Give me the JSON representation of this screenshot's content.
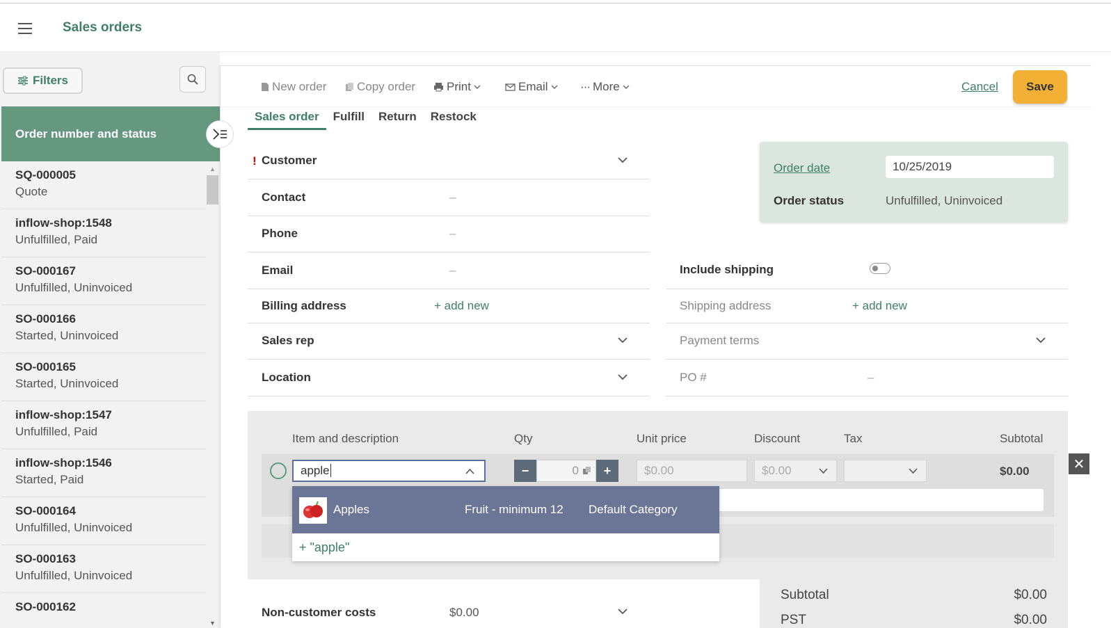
{
  "header": {
    "title": "Sales orders"
  },
  "left": {
    "filters_label": "Filters",
    "list_header": "Order number and status",
    "orders": [
      {
        "num": "SQ-000005",
        "status": "Quote"
      },
      {
        "num": "inflow-shop:1548",
        "status": "Unfulfilled, Paid"
      },
      {
        "num": "SO-000167",
        "status": "Unfulfilled, Uninvoiced"
      },
      {
        "num": "SO-000166",
        "status": "Started, Uninvoiced"
      },
      {
        "num": "SO-000165",
        "status": "Started, Uninvoiced"
      },
      {
        "num": "inflow-shop:1547",
        "status": "Unfulfilled, Paid"
      },
      {
        "num": "inflow-shop:1546",
        "status": "Started, Paid"
      },
      {
        "num": "SO-000164",
        "status": "Unfulfilled, Uninvoiced"
      },
      {
        "num": "SO-000163",
        "status": "Unfulfilled, Uninvoiced"
      },
      {
        "num": "SO-000162",
        "status": ""
      }
    ]
  },
  "toolbar": {
    "new_order": "New order",
    "copy_order": "Copy order",
    "print": "Print",
    "email": "Email",
    "more": "More",
    "cancel": "Cancel",
    "save": "Save"
  },
  "tabs": [
    "Sales order",
    "Fulfill",
    "Return",
    "Restock"
  ],
  "form": {
    "customer": "Customer",
    "required_mark": "!",
    "contact": "Contact",
    "phone": "Phone",
    "email": "Email",
    "billing_address": "Billing address",
    "add_new": "+ add new",
    "sales_rep": "Sales rep",
    "location": "Location",
    "include_shipping": "Include shipping",
    "shipping_address": "Shipping address",
    "payment_terms": "Payment terms",
    "po": "PO #",
    "dash": "–"
  },
  "order_info": {
    "date_label": "Order date",
    "date_value": "10/25/2019",
    "status_label": "Order status",
    "status_value": "Unfulfilled, Uninvoiced"
  },
  "items": {
    "columns": {
      "item": "Item and description",
      "qty": "Qty",
      "unit_price": "Unit price",
      "discount": "Discount",
      "tax": "Tax",
      "subtotal": "Subtotal"
    },
    "row": {
      "item_value": "apple",
      "qty": "0",
      "unit_price": "$0.00",
      "discount": "$0.00",
      "subtotal": "$0.00"
    },
    "dropdown": {
      "name": "Apples",
      "desc": "Fruit - minimum 12",
      "category": "Default Category",
      "add_text": "+  \"apple\""
    }
  },
  "non_customer_costs": {
    "label": "Non-customer costs",
    "value": "$0.00"
  },
  "totals": {
    "subtotal_label": "Subtotal",
    "subtotal_value": "$0.00",
    "tax_label": "PST",
    "tax_value": "$0.00"
  },
  "colors": {
    "accent": "#3f7f67",
    "save": "#f2b035",
    "dropdown": "#6b7595"
  }
}
